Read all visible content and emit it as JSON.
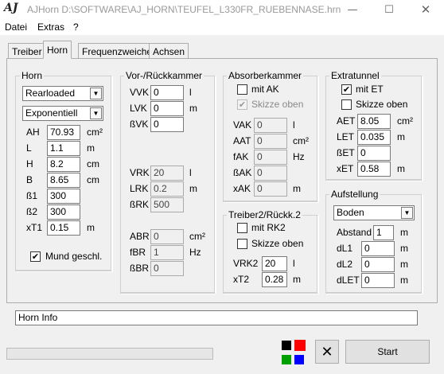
{
  "window": {
    "app_icon": "AJ",
    "title": "AJHorn  D:\\SOFTWARE\\AJ_HORN\\TEUFEL_L330FR_RUEBENNASE.hrn",
    "minimize_icon": "minimize-icon",
    "maximize_icon": "maximize-icon",
    "close_icon": "close-icon"
  },
  "menu": [
    "Datei",
    "Extras",
    "?"
  ],
  "tabs": [
    "Treiber",
    "Horn",
    "Frequenzweiche",
    "Achsen"
  ],
  "active_tab": "Horn",
  "horn": {
    "label": "Horn",
    "type_select": "Rearloaded",
    "profile_select": "Exponentiell",
    "rows": [
      {
        "name": "AH",
        "value": "70.93",
        "unit": "cm²"
      },
      {
        "name": "L",
        "value": "1.1",
        "unit": "m"
      },
      {
        "name": "H",
        "value": "8.2",
        "unit": "cm"
      },
      {
        "name": "B",
        "value": "8.65",
        "unit": "cm"
      },
      {
        "name": "ß1",
        "value": "300",
        "unit": ""
      },
      {
        "name": "ß2",
        "value": "300",
        "unit": ""
      },
      {
        "name": "xT1",
        "value": "0.15",
        "unit": "m"
      }
    ],
    "mund_label": "Mund geschl.",
    "mund_checked": "✔"
  },
  "vor": {
    "label": "Vor-/Rückkammer",
    "rows_top": [
      {
        "name": "VVK",
        "value": "0",
        "unit": "l"
      },
      {
        "name": "LVK",
        "value": "0",
        "unit": "m"
      },
      {
        "name": "ßVK",
        "value": "0",
        "unit": ""
      }
    ],
    "rows_mid": [
      {
        "name": "VRK",
        "value": "20",
        "unit": "l"
      },
      {
        "name": "LRK",
        "value": "0.2",
        "unit": "m"
      },
      {
        "name": "ßRK",
        "value": "500",
        "unit": ""
      }
    ],
    "rows_bot": [
      {
        "name": "ABR",
        "value": "0",
        "unit": "cm²"
      },
      {
        "name": "fBR",
        "value": "1",
        "unit": "Hz"
      },
      {
        "name": "ßBR",
        "value": "0",
        "unit": ""
      }
    ]
  },
  "absorber": {
    "label": "Absorberkammer",
    "mit_ak_label": "mit AK",
    "skizze_label": "Skizze oben",
    "skizze_checked": "✔",
    "rows": [
      {
        "name": "VAK",
        "value": "0",
        "unit": "l"
      },
      {
        "name": "AAT",
        "value": "0",
        "unit": "cm²"
      },
      {
        "name": "fAK",
        "value": "0",
        "unit": "Hz"
      },
      {
        "name": "ßAK",
        "value": "0",
        "unit": ""
      },
      {
        "name": "xAK",
        "value": "0",
        "unit": "m"
      }
    ]
  },
  "treiber2": {
    "label": "Treiber2/Rückk.2",
    "mit_rk2_label": "mit RK2",
    "skizze_label": "Skizze oben",
    "rows": [
      {
        "name": "VRK2",
        "value": "20",
        "unit": "l"
      },
      {
        "name": "xT2",
        "value": "0.28",
        "unit": "m"
      }
    ]
  },
  "extratunnel": {
    "label": "Extratunnel",
    "mit_et_label": "mit ET",
    "mit_et_checked": "✔",
    "skizze_label": "Skizze oben",
    "rows": [
      {
        "name": "AET",
        "value": "8.05",
        "unit": "cm²"
      },
      {
        "name": "LET",
        "value": "0.035",
        "unit": "m"
      },
      {
        "name": "ßET",
        "value": "0",
        "unit": ""
      },
      {
        "name": "xET",
        "value": "0.58",
        "unit": "m"
      }
    ]
  },
  "aufstellung": {
    "label": "Aufstellung",
    "select": "Boden",
    "rows": [
      {
        "name": "Abstand",
        "value": "1",
        "unit": "m"
      },
      {
        "name": "dL1",
        "value": "0",
        "unit": "m"
      },
      {
        "name": "dL2",
        "value": "0",
        "unit": "m"
      },
      {
        "name": "dLET",
        "value": "0",
        "unit": "m"
      }
    ]
  },
  "horn_info": "Horn Info",
  "colors": {
    "black": "#000000",
    "red": "#ff0000",
    "green": "#00a000",
    "blue": "#0000ff"
  },
  "cancel_icon": "close-x-icon",
  "start_label": "Start"
}
